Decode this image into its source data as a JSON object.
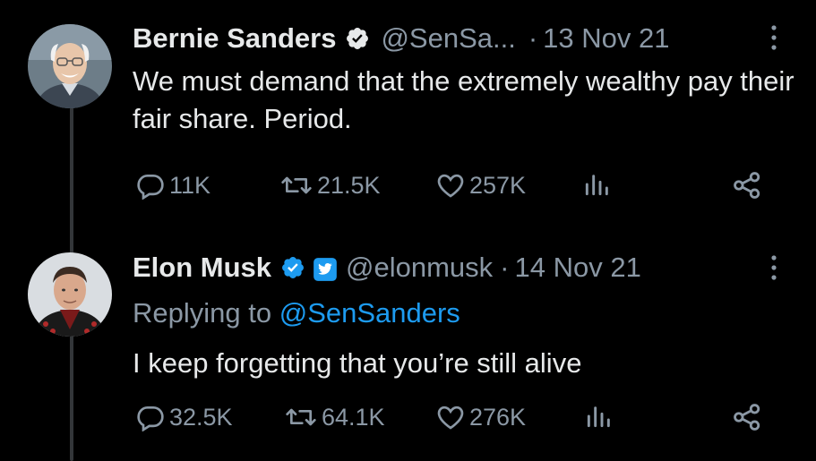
{
  "tweets": [
    {
      "name": "Bernie Sanders",
      "handle": "@SenSa...",
      "date": "13 Nov 21",
      "dot": "·",
      "text": "We must demand that the extremely wealthy pay their fair share. Period.",
      "replies": "11K",
      "retweets": "21.5K",
      "likes": "257K"
    },
    {
      "name": "Elon Musk",
      "handle": "@elonmusk",
      "date": "14 Nov 21",
      "dot": "·",
      "replying_prefix": "Replying to ",
      "replying_to": "@SenSanders",
      "text": "I keep forgetting that you’re still alive",
      "replies": "32.5K",
      "retweets": "64.1K",
      "likes": "276K"
    }
  ],
  "icons": {
    "verified": "verified-badge-icon",
    "government": "government-badge-icon",
    "more": "more-options-icon",
    "reply": "reply-icon",
    "retweet": "retweet-icon",
    "like": "heart-icon",
    "views": "views-chart-icon",
    "share": "share-icon"
  },
  "colors": {
    "background": "#000000",
    "text": "#e7e9ea",
    "secondary": "#8b98a5",
    "accent": "#1d9bf0"
  }
}
